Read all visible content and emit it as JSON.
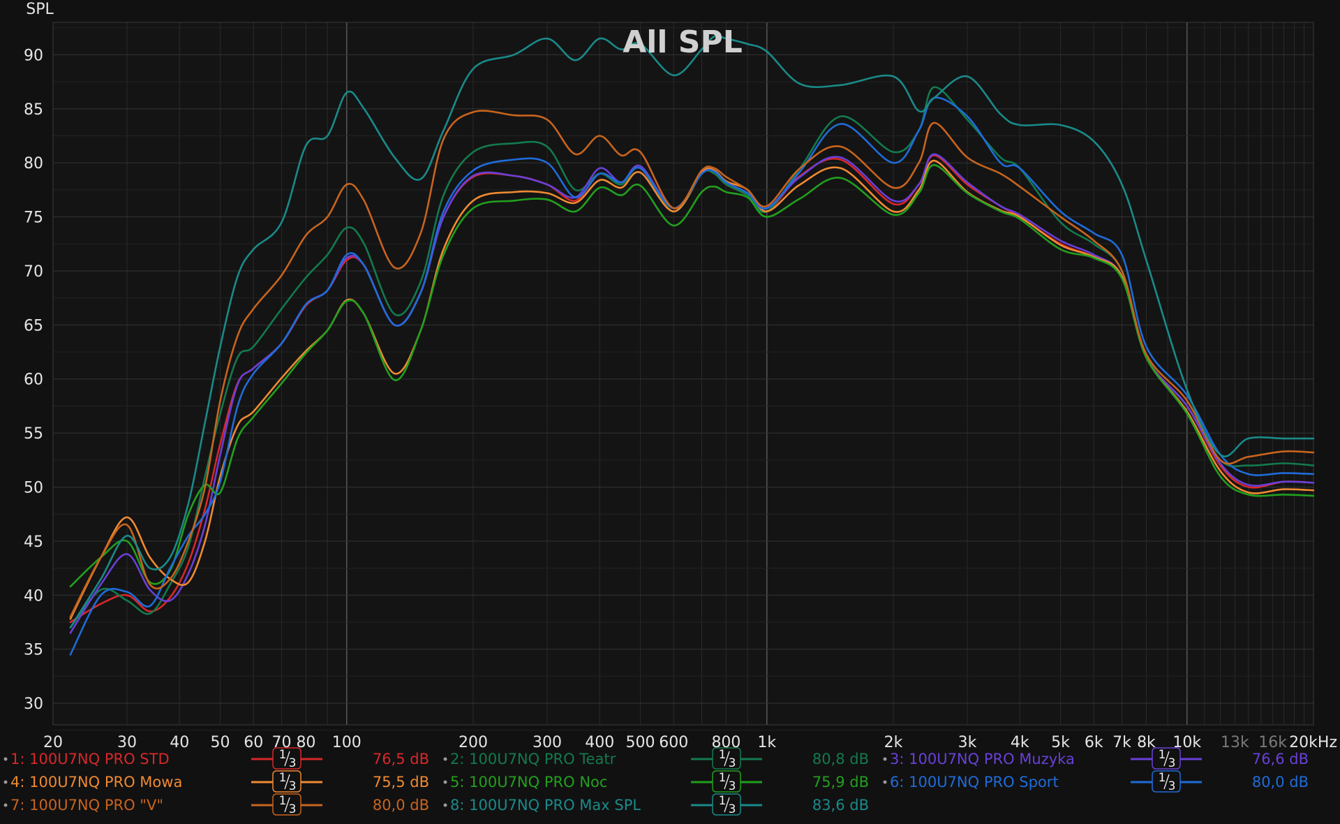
{
  "colors": {
    "background": "#111111",
    "plot_background": "#141414",
    "grid_major": "#3c3c3c",
    "grid_minor": "#262626"
  },
  "chart_data": {
    "type": "line",
    "title": "All SPL",
    "ylabel": "SPL",
    "xlabel": "",
    "x_scale": "log",
    "xlim": [
      20,
      20000
    ],
    "ylim": [
      28,
      93
    ],
    "grid": true,
    "y_ticks": [
      "30",
      "35",
      "40",
      "45",
      "50",
      "55",
      "60",
      "65",
      "70",
      "75",
      "80",
      "85",
      "90"
    ],
    "x_ticks": [
      {
        "f": 20,
        "label": "20"
      },
      {
        "f": 30,
        "label": "30"
      },
      {
        "f": 40,
        "label": "40"
      },
      {
        "f": 50,
        "label": "50"
      },
      {
        "f": 60,
        "label": "60"
      },
      {
        "f": 70,
        "label": "70"
      },
      {
        "f": 80,
        "label": "80"
      },
      {
        "f": 100,
        "label": "100"
      },
      {
        "f": 200,
        "label": "200"
      },
      {
        "f": 300,
        "label": "300"
      },
      {
        "f": 400,
        "label": "400"
      },
      {
        "f": 500,
        "label": "500"
      },
      {
        "f": 600,
        "label": "600"
      },
      {
        "f": 800,
        "label": "800"
      },
      {
        "f": 1000,
        "label": "1k"
      },
      {
        "f": 2000,
        "label": "2k"
      },
      {
        "f": 3000,
        "label": "3k"
      },
      {
        "f": 4000,
        "label": "4k"
      },
      {
        "f": 5000,
        "label": "5k"
      },
      {
        "f": 6000,
        "label": "6k"
      },
      {
        "f": 7000,
        "label": "7k"
      },
      {
        "f": 8000,
        "label": "8k"
      },
      {
        "f": 10000,
        "label": "10k"
      },
      {
        "f": 13000,
        "label": "13k",
        "dim": true
      },
      {
        "f": 16000,
        "label": "16k",
        "dim": true
      },
      {
        "f": 20000,
        "label": "20kHz"
      }
    ],
    "smoothing_label": "1/3",
    "series": [
      {
        "name": "1: 100U7NQ PRO STD",
        "color": "#d8282a",
        "level": "76,5 dB",
        "x": [
          22,
          26,
          30,
          34,
          38,
          42,
          46,
          50,
          55,
          60,
          70,
          80,
          90,
          100,
          110,
          130,
          150,
          170,
          200,
          250,
          300,
          350,
          400,
          450,
          500,
          600,
          700,
          750,
          800,
          900,
          1000,
          1200,
          1500,
          2000,
          2300,
          2500,
          3000,
          3600,
          4000,
          5000,
          6000,
          7000,
          8000,
          10000,
          12000,
          14000,
          17000,
          20000
        ],
        "y": [
          37.5,
          39.2,
          40,
          38.5,
          39.8,
          43,
          48,
          54,
          59.6,
          61,
          63.3,
          66.8,
          68.2,
          71,
          70.5,
          65,
          68,
          75,
          78.7,
          78.8,
          78,
          76.5,
          79,
          78,
          79.5,
          75.5,
          79,
          79,
          78,
          77,
          75.5,
          78.8,
          80.3,
          76.2,
          78,
          80.7,
          78,
          76,
          75,
          72.5,
          71.3,
          69.5,
          62,
          57.5,
          52,
          50,
          50.5,
          50.4
        ]
      },
      {
        "name": "2: 100U7NQ PRO Teatr",
        "color": "#137a4e",
        "level": "80,8 dB",
        "x": [
          22,
          26,
          30,
          34,
          38,
          42,
          46,
          50,
          55,
          60,
          70,
          80,
          90,
          100,
          110,
          130,
          150,
          170,
          200,
          250,
          300,
          350,
          400,
          450,
          500,
          600,
          700,
          750,
          800,
          900,
          1000,
          1200,
          1500,
          2000,
          2300,
          2500,
          3000,
          3600,
          4000,
          5000,
          6000,
          7000,
          8000,
          10000,
          12000,
          14000,
          17000,
          20000
        ],
        "y": [
          37,
          40.5,
          39.5,
          38.3,
          41,
          44.5,
          51,
          56.8,
          62,
          63,
          66.5,
          69.4,
          71.5,
          74,
          72.5,
          66,
          69,
          77,
          81,
          81.8,
          81.5,
          77.5,
          79,
          78,
          79.5,
          75.5,
          79,
          79,
          78,
          77,
          75.5,
          79.5,
          84.3,
          81,
          83,
          87,
          84,
          80.5,
          79.5,
          74.5,
          72.5,
          70,
          62,
          57.5,
          52.5,
          52,
          52.2,
          52
        ]
      },
      {
        "name": "3: 100U7NQ PRO Muzyka",
        "color": "#6a40d8",
        "level": "76,6 dB",
        "x": [
          22,
          26,
          30,
          34,
          38,
          42,
          46,
          50,
          55,
          60,
          70,
          80,
          90,
          100,
          110,
          130,
          150,
          170,
          200,
          250,
          300,
          350,
          400,
          450,
          500,
          600,
          700,
          750,
          800,
          900,
          1000,
          1200,
          1500,
          2000,
          2300,
          2500,
          3000,
          3600,
          4000,
          5000,
          6000,
          7000,
          8000,
          10000,
          12000,
          14000,
          17000,
          20000
        ],
        "y": [
          36.5,
          41,
          43.8,
          40.5,
          39.5,
          42,
          46.5,
          53,
          59.5,
          61,
          63.3,
          66.9,
          68.2,
          71.2,
          70.5,
          65,
          68,
          75,
          78.8,
          78.8,
          78,
          76.8,
          79.5,
          78.2,
          79.7,
          75.8,
          79,
          79.2,
          78.2,
          77.2,
          75.8,
          78.7,
          80.5,
          76.5,
          78,
          80.8,
          78.2,
          76,
          75.2,
          72.8,
          71.5,
          69.5,
          62,
          57.5,
          52.2,
          50.2,
          50.5,
          50.4
        ]
      },
      {
        "name": "4: 100U7NQ PRO Mowa",
        "color": "#f08a32",
        "level": "75,5 dB",
        "x": [
          22,
          26,
          30,
          34,
          38,
          42,
          46,
          50,
          55,
          60,
          70,
          80,
          90,
          100,
          110,
          130,
          150,
          170,
          200,
          250,
          300,
          350,
          400,
          450,
          500,
          600,
          700,
          750,
          800,
          900,
          1000,
          1200,
          1500,
          2000,
          2300,
          2500,
          3000,
          3600,
          4000,
          5000,
          6000,
          7000,
          8000,
          10000,
          12000,
          14000,
          17000,
          20000
        ],
        "y": [
          37.8,
          43.5,
          47.2,
          43.5,
          41.5,
          41.2,
          45,
          51,
          55.7,
          57,
          60.1,
          62.6,
          64.5,
          67.3,
          66,
          60.5,
          64.5,
          72,
          76.5,
          77.3,
          77.2,
          76.3,
          78.4,
          77.7,
          79.1,
          75.5,
          79.1,
          79.3,
          78.3,
          77.5,
          75.5,
          78,
          79.5,
          75.5,
          77.5,
          80.2,
          77.3,
          75.6,
          75,
          72.4,
          71.3,
          69.5,
          62,
          57,
          51.5,
          49.5,
          49.8,
          49.7
        ]
      },
      {
        "name": "5: 100U7NQ PRO Noc",
        "color": "#22a01e",
        "level": "75,9 dB",
        "x": [
          22,
          26,
          30,
          34,
          38,
          42,
          46,
          50,
          55,
          60,
          70,
          80,
          90,
          100,
          110,
          130,
          150,
          170,
          200,
          250,
          300,
          350,
          400,
          450,
          500,
          600,
          700,
          750,
          800,
          900,
          1000,
          1200,
          1500,
          2000,
          2300,
          2500,
          3000,
          3600,
          4000,
          5000,
          6000,
          7000,
          8000,
          10000,
          12000,
          14000,
          17000,
          20000
        ],
        "y": [
          40.8,
          43.5,
          45,
          41.2,
          42.3,
          47.5,
          50.2,
          49.5,
          54.5,
          56.5,
          59.6,
          62.4,
          64.5,
          67.2,
          66,
          59.9,
          64.5,
          71.5,
          75.8,
          76.5,
          76.6,
          75.5,
          77.7,
          77,
          77.9,
          74.2,
          77.3,
          77.8,
          77.3,
          76.8,
          75,
          76.7,
          78.6,
          75.2,
          77.2,
          79.8,
          77.2,
          75.5,
          74.8,
          72,
          71.2,
          69.3,
          62,
          56.8,
          51,
          49.3,
          49.3,
          49.2
        ]
      },
      {
        "name": "6: 100U7NQ PRO Sport",
        "color": "#1f6cd9",
        "level": "80,0 dB",
        "x": [
          22,
          26,
          30,
          34,
          38,
          42,
          46,
          50,
          55,
          60,
          70,
          80,
          90,
          100,
          110,
          130,
          150,
          170,
          200,
          250,
          300,
          350,
          400,
          450,
          500,
          600,
          700,
          750,
          800,
          900,
          1000,
          1200,
          1500,
          2000,
          2300,
          2500,
          3000,
          3600,
          4000,
          5000,
          6000,
          7000,
          8000,
          10000,
          12000,
          14000,
          17000,
          20000
        ],
        "y": [
          34.5,
          40,
          40.3,
          39,
          42.5,
          45.5,
          47.5,
          50.5,
          57.5,
          60.5,
          63.3,
          66.9,
          68.2,
          71.5,
          70.5,
          65,
          68,
          75.5,
          79.3,
          80.3,
          80,
          76.8,
          79,
          78.2,
          79.5,
          75.8,
          79,
          79.2,
          78.2,
          77.2,
          75.8,
          79.2,
          83.6,
          80,
          83,
          86,
          84.3,
          80,
          79.5,
          75.5,
          73.5,
          71.5,
          63,
          58.5,
          53,
          51.2,
          51.3,
          51.2
        ]
      },
      {
        "name": "7: 100U7NQ PRO \"V\"",
        "color": "#c8641e",
        "level": "80,0 dB",
        "x": [
          22,
          26,
          30,
          34,
          38,
          42,
          46,
          50,
          55,
          60,
          70,
          80,
          90,
          100,
          110,
          130,
          150,
          170,
          200,
          250,
          300,
          350,
          400,
          450,
          500,
          600,
          700,
          750,
          800,
          900,
          1000,
          1200,
          1500,
          2000,
          2300,
          2500,
          3000,
          3600,
          4000,
          5000,
          6000,
          7000,
          8000,
          10000,
          12000,
          14000,
          17000,
          20000
        ],
        "y": [
          38,
          43.5,
          46.5,
          41,
          41.5,
          45,
          50,
          58,
          64,
          66.5,
          69.6,
          73.3,
          75,
          78,
          76.5,
          70.3,
          73.5,
          82.2,
          84.7,
          84.4,
          84,
          80.8,
          82.5,
          80.7,
          81,
          75.8,
          79.3,
          79.5,
          78.7,
          77.5,
          76,
          79.5,
          81.5,
          77.7,
          80,
          83.7,
          80.5,
          79,
          77.8,
          75,
          72.8,
          70,
          62.3,
          58,
          52.5,
          52.8,
          53.3,
          53.2
        ]
      },
      {
        "name": "8: 100U7NQ PRO Max SPL",
        "color": "#1a8a8a",
        "level": "83,6 dB",
        "x": [
          22,
          26,
          30,
          34,
          38,
          42,
          46,
          50,
          55,
          60,
          70,
          80,
          90,
          100,
          110,
          130,
          150,
          170,
          200,
          250,
          300,
          350,
          400,
          450,
          500,
          600,
          700,
          750,
          800,
          900,
          1000,
          1200,
          1500,
          2000,
          2300,
          2500,
          3000,
          3600,
          4000,
          5000,
          6000,
          7000,
          8000,
          10000,
          12000,
          14000,
          17000,
          20000
        ],
        "y": [
          37,
          41.5,
          45.5,
          42.5,
          43.5,
          48.5,
          56,
          63,
          69.5,
          72,
          74.5,
          81.6,
          82.5,
          86.5,
          85,
          80.5,
          78.5,
          83,
          88.7,
          90,
          91.5,
          89.5,
          91.5,
          90.5,
          91,
          88.1,
          90.5,
          91.7,
          91.5,
          91,
          90.3,
          87.3,
          87.2,
          88,
          84.8,
          86,
          88,
          84.5,
          83.5,
          83.5,
          82,
          78,
          71,
          59,
          53,
          54.5,
          54.5,
          54.5
        ]
      }
    ]
  }
}
